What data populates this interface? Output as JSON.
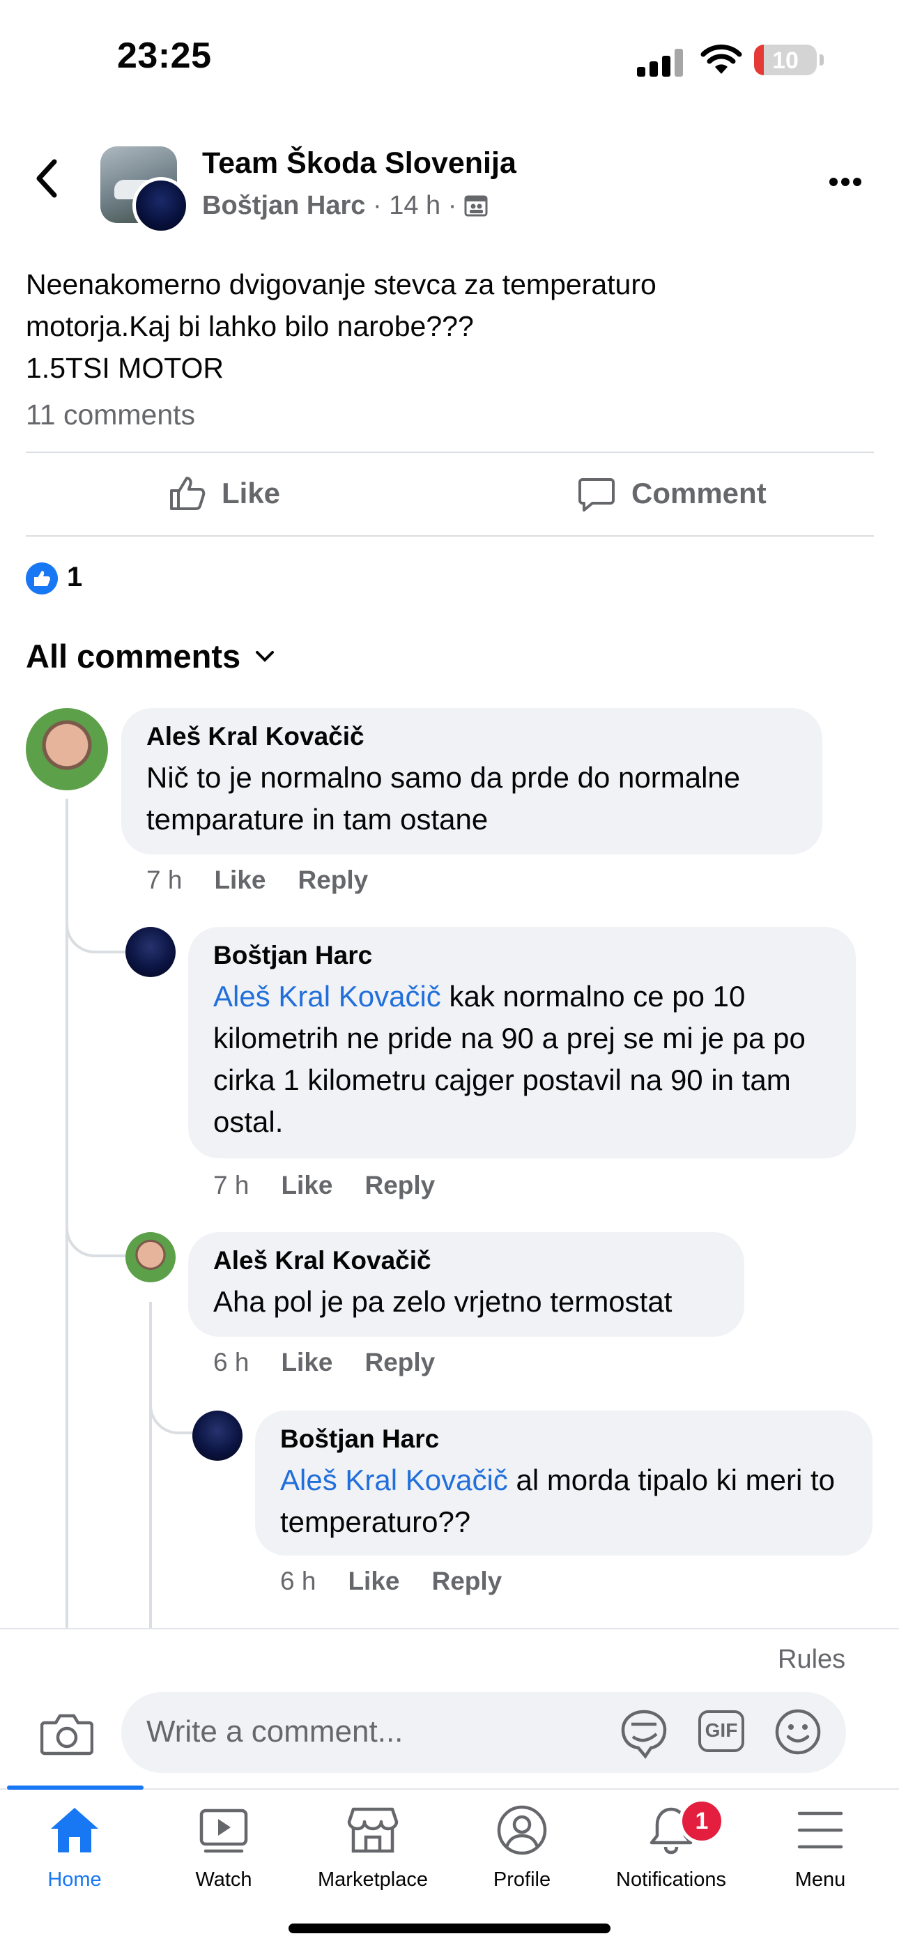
{
  "status_bar": {
    "time": "23:25",
    "battery": "10"
  },
  "header": {
    "group_name": "Team Škoda Slovenija",
    "author": "Boštjan Harc",
    "time_ago": "14 h"
  },
  "post": {
    "text_line1": "Neenakomerno dvigovanje stevca za temperaturo",
    "text_line2": "motorja.Kaj bi lahko bilo narobe???",
    "text_line3": "1.5TSI MOTOR",
    "comments_count": "11 comments",
    "like_label": "Like",
    "comment_label": "Comment",
    "reaction_count": "1"
  },
  "comments_header": {
    "label": "All comments"
  },
  "comments": [
    {
      "author": "Aleš Kral Kovačič",
      "text": "Nič to je normalno samo da prde do normalne temparature in tam ostane",
      "time": "7 h",
      "like": "Like",
      "reply": "Reply"
    },
    {
      "author": "Boštjan Harc",
      "mention": "Aleš Kral Kovačič",
      "text": " kak normalno ce po 10 kilometrih ne pride na 90 a prej se mi je pa po cirka 1 kilometru cajger postavil na 90 in tam ostal.",
      "time": "7 h",
      "like": "Like",
      "reply": "Reply"
    },
    {
      "author": "Aleš Kral Kovačič",
      "text": "Aha pol je pa zelo vrjetno termostat",
      "time": "6 h",
      "like": "Like",
      "reply": "Reply"
    },
    {
      "author": "Boštjan Harc",
      "mention": "Aleš Kral Kovačič",
      "text": " al morda tipalo ki meri to temperaturo??",
      "time": "6 h",
      "like": "Like",
      "reply": "Reply"
    }
  ],
  "composer": {
    "rules": "Rules",
    "placeholder": "Write a comment...",
    "gif": "GIF"
  },
  "tabs": [
    {
      "label": "Home",
      "icon": "home-icon",
      "active": true
    },
    {
      "label": "Watch",
      "icon": "watch-icon"
    },
    {
      "label": "Marketplace",
      "icon": "marketplace-icon"
    },
    {
      "label": "Profile",
      "icon": "profile-icon"
    },
    {
      "label": "Notifications",
      "icon": "bell-icon",
      "badge": "1"
    },
    {
      "label": "Menu",
      "icon": "menu-icon"
    }
  ],
  "colors": {
    "accent": "#1877f2",
    "mention": "#216fdb",
    "bubble": "#f0f2f5",
    "badge": "#e41e3f"
  }
}
